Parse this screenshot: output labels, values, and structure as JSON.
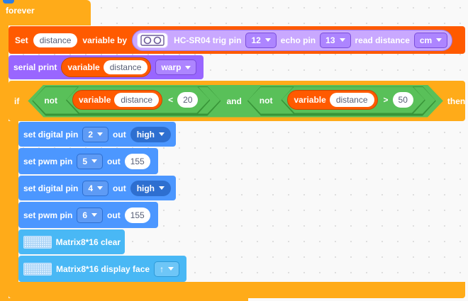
{
  "forever": {
    "label": "forever"
  },
  "set_block": {
    "set_label": "Set",
    "variable_name": "distance",
    "by_label": "variable by",
    "sensor_icon": "ultrasonic-sensor-icon",
    "sensor_label": "HC-SR04 trig pin",
    "trig_pin": "12",
    "echo_label": "echo pin",
    "echo_pin": "13",
    "read_label": "read distance",
    "unit": "cm"
  },
  "serial_print": {
    "label": "serial print",
    "variable_label": "variable",
    "variable_name": "distance",
    "mode": "warp"
  },
  "if_block": {
    "if_label": "if",
    "not1_label": "not",
    "var1_label": "variable",
    "var1_name": "distance",
    "op1": "<",
    "value1": "20",
    "and_label": "and",
    "not2_label": "not",
    "var2_label": "variable",
    "var2_name": "distance",
    "op2": ">",
    "value2": "50",
    "then_label": "then"
  },
  "body_blocks": [
    {
      "label": "set digital pin",
      "pin": "2",
      "out_label": "out",
      "value": "high"
    },
    {
      "label": "set pwm pin",
      "pin": "5",
      "out_label": "out",
      "value": "155"
    },
    {
      "label": "set digital pin",
      "pin": "4",
      "out_label": "out",
      "value": "high"
    },
    {
      "label": "set pwm pin",
      "pin": "6",
      "out_label": "out",
      "value": "155"
    }
  ],
  "matrix_clear": {
    "icon": "led-matrix-icon",
    "label": "Matrix8*16 clear"
  },
  "matrix_face": {
    "icon": "led-matrix-icon",
    "label": "Matrix8*16 display face",
    "face": "↑"
  }
}
